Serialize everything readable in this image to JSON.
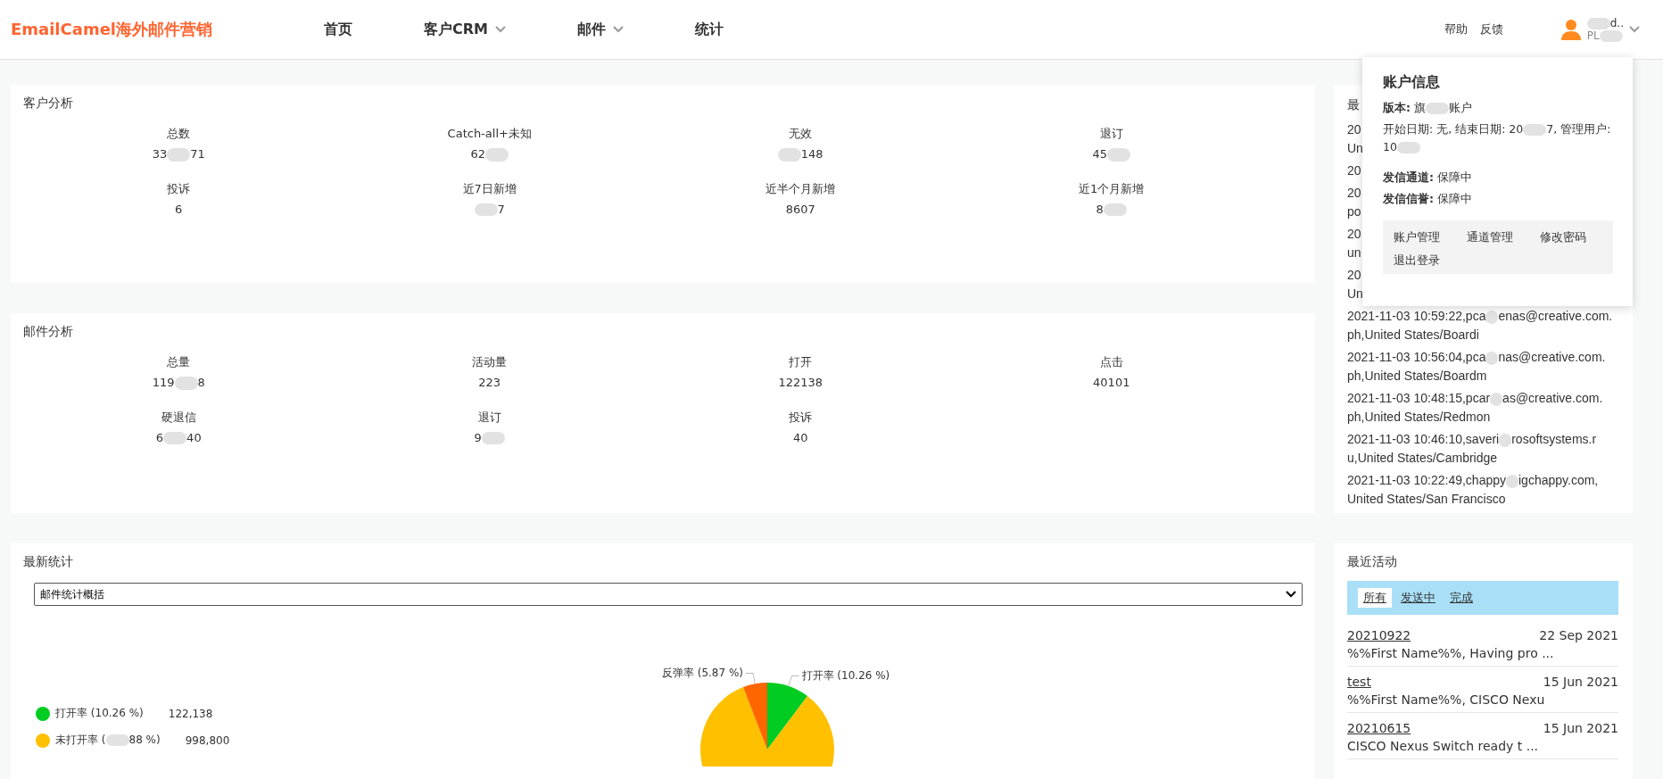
{
  "header": {
    "logo": "EmailCamel海外邮件营销",
    "nav": [
      {
        "label": "首页",
        "dropdown": false
      },
      {
        "label": "客户CRM",
        "dropdown": true
      },
      {
        "label": "邮件",
        "dropdown": true
      },
      {
        "label": "统计",
        "dropdown": false
      }
    ],
    "links": [
      "帮助",
      "反馈"
    ],
    "user": {
      "name": [
        "d.."
      ],
      "name_redacted_head": true,
      "sub": [
        "PL"
      ],
      "sub_redacted_tail": true
    }
  },
  "customer_analysis": {
    "title": "客户分析",
    "stats": [
      {
        "label": "总数",
        "value": [
          "33",
          "71"
        ]
      },
      {
        "label": "Catch-all+未知",
        "value": [
          "62"
        ],
        "redacted_tail": true
      },
      {
        "label": "无效",
        "value": [
          "148"
        ],
        "redacted_head": true
      },
      {
        "label": "退订",
        "value": [
          "45"
        ],
        "redacted_tail": true
      },
      {
        "label": "投诉",
        "value": [
          "6"
        ]
      },
      {
        "label": "近7日新增",
        "value": [
          "7"
        ],
        "redacted_head": true
      },
      {
        "label": "近半个月新增",
        "value": [
          "8607"
        ]
      },
      {
        "label": "近1个月新增",
        "value": [
          "8"
        ],
        "redacted_tail": true
      }
    ]
  },
  "mail_analysis": {
    "title": "邮件分析",
    "stats": [
      {
        "label": "总量",
        "value": [
          "119",
          "8"
        ]
      },
      {
        "label": "活动量",
        "value": [
          "223"
        ]
      },
      {
        "label": "打开",
        "value": [
          "122138"
        ]
      },
      {
        "label": "点击",
        "value": [
          "40101"
        ]
      },
      {
        "label": "硬退信",
        "value": [
          "6",
          "40"
        ]
      },
      {
        "label": "退订",
        "value": [
          "9"
        ],
        "redacted_tail": true
      },
      {
        "label": "投诉",
        "value": [
          "40"
        ]
      }
    ]
  },
  "latest_stats": {
    "title": "最新统计",
    "select": {
      "value": "邮件统计概括"
    },
    "chart_data": {
      "type": "pie",
      "categories": [
        "打开率 (10.26 %)",
        null,
        "反弹率 (5.87 %)"
      ],
      "values": [
        10.26,
        83.87,
        5.87
      ],
      "colors": [
        "#00cc22",
        "#ffc000",
        "#ff6600"
      ]
    },
    "legend": [
      {
        "label": [
          "打开率 (10.26 %)"
        ],
        "value": "122,138",
        "color": "#00cc22"
      },
      {
        "label": [
          "未打开率 (",
          "88 %)"
        ],
        "value": "998,800",
        "color": "#ffc000"
      }
    ]
  },
  "recent_opens": {
    "title": "最",
    "rows": [
      {
        "lines": [
          [
            "20"
          ],
          [
            "Un"
          ]
        ]
      },
      {
        "lines": [
          [
            "20"
          ]
        ]
      },
      {
        "lines": [
          [
            "20"
          ],
          [
            "po"
          ]
        ]
      },
      {
        "lines": [
          [
            "20"
          ],
          [
            "un"
          ]
        ]
      },
      {
        "lines": [
          [
            "20"
          ],
          [
            "Un"
          ]
        ]
      },
      {
        "lines": [
          [
            "2021-11-03 10:59:22,pca",
            "enas@creative.com."
          ],
          [
            "ph,United States/Boardi"
          ]
        ]
      },
      {
        "lines": [
          [
            "2021-11-03 10:56:04,pca",
            "nas@creative.com."
          ],
          [
            "ph,United States/Boardm"
          ]
        ]
      },
      {
        "lines": [
          [
            "2021-11-03 10:48:15,pcar",
            "as@creative.com."
          ],
          [
            "ph,United States/Redmon"
          ]
        ]
      },
      {
        "lines": [
          [
            "2021-11-03 10:46:10,saveri",
            "rosoftsystems.r"
          ],
          [
            "u,United States/Cambridge"
          ]
        ]
      },
      {
        "lines": [
          [
            "2021-11-03 10:22:49,chappy",
            "igchappy.com,"
          ],
          [
            "United States/San Francisco"
          ]
        ]
      }
    ]
  },
  "account_popup": {
    "title": "账户信息",
    "edition": {
      "label": "版本:",
      "value": [
        "旗",
        "账户"
      ]
    },
    "dates": [
      "开始日期: 无, 结束日期: 20",
      "7, 管理用户: 10"
    ],
    "dates_redacted_tail": true,
    "status": [
      {
        "label": "发信通道:",
        "value": "保障中"
      },
      {
        "label": "发信信誉:",
        "value": "保障中"
      }
    ],
    "actions": [
      "账户管理",
      "通道管理",
      "修改密码",
      "退出登录"
    ]
  },
  "recent_activity": {
    "title": "最近活动",
    "tabs": [
      {
        "label": "所有",
        "selected": true
      },
      {
        "label": "发送中",
        "selected": false
      },
      {
        "label": "完成",
        "selected": false
      }
    ],
    "items": [
      {
        "name": "20210922",
        "date": "22 Sep 2021",
        "preview": "%%First Name%%, Having pro ..."
      },
      {
        "name": "test",
        "date": "15 Jun 2021",
        "preview": "%%First Name%%, CISCO Nexu"
      },
      {
        "name": "20210615",
        "date": "15 Jun 2021",
        "preview": "CISCO Nexus Switch ready t ..."
      }
    ]
  }
}
